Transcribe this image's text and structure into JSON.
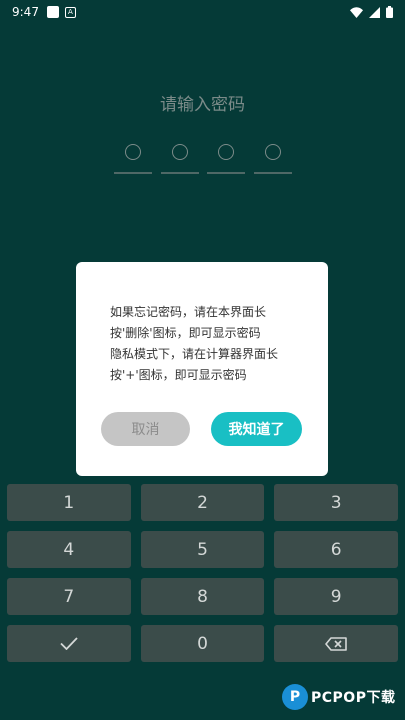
{
  "status_bar": {
    "time": "9:47",
    "icons": [
      "notification-square-icon",
      "a-badge-icon",
      "wifi-icon",
      "signal-icon",
      "battery-icon"
    ]
  },
  "lock_screen": {
    "title": "请输入密码",
    "pin_length": 4
  },
  "keypad": {
    "keys": [
      {
        "label": "1",
        "name": "key-1"
      },
      {
        "label": "2",
        "name": "key-2"
      },
      {
        "label": "3",
        "name": "key-3"
      },
      {
        "label": "4",
        "name": "key-4"
      },
      {
        "label": "5",
        "name": "key-5"
      },
      {
        "label": "6",
        "name": "key-6"
      },
      {
        "label": "7",
        "name": "key-7"
      },
      {
        "label": "8",
        "name": "key-8"
      },
      {
        "label": "9",
        "name": "key-9"
      },
      {
        "label": "",
        "name": "key-confirm",
        "icon": "checkmark-icon"
      },
      {
        "label": "0",
        "name": "key-0"
      },
      {
        "label": "",
        "name": "key-backspace",
        "icon": "backspace-icon"
      }
    ]
  },
  "dialog": {
    "lines": [
      "如果忘记密码，请在本界面长",
      "按'删除'图标，即可显示密码",
      "隐私模式下，请在计算器界面长",
      "按'+'图标，即可显示密码"
    ],
    "cancel_label": "取消",
    "ok_label": "我知道了"
  },
  "watermark": {
    "logo_letter": "P",
    "text": "PCPOP下载"
  },
  "colors": {
    "background": "#053a37",
    "key": "#3b4c4a",
    "accent": "#19bfc4",
    "cancel": "#c5c5c5"
  }
}
